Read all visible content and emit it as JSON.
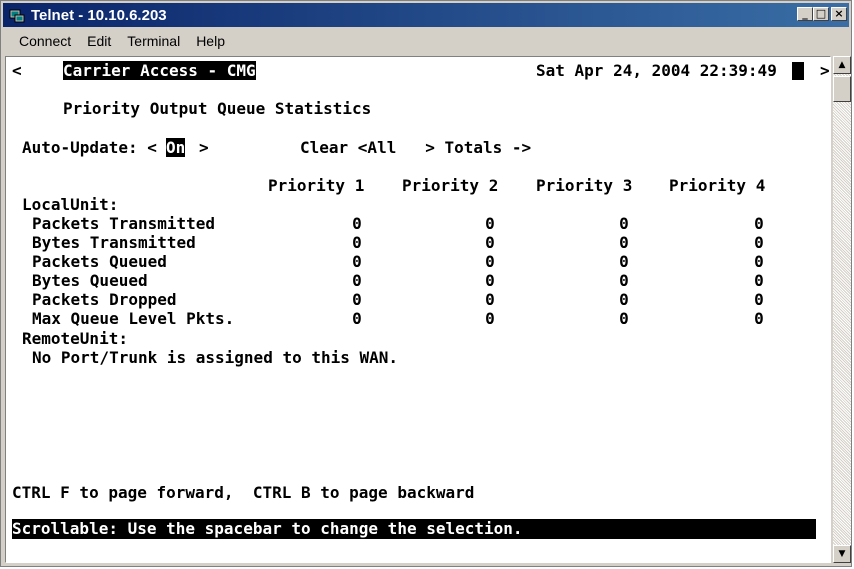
{
  "window": {
    "title": "Telnet - 10.10.6.203",
    "icon": "telnet-app-icon",
    "controls": {
      "minimize": "_",
      "maximize": "□",
      "close": "×"
    }
  },
  "menu": [
    "Connect",
    "Edit",
    "Terminal",
    "Help"
  ],
  "terminal": {
    "nav_left": "<",
    "nav_right": ">",
    "header": "Carrier Access - CMG",
    "datetime": "Sat Apr 24, 2004 22:39:49",
    "screen_title": "Priority Output Queue Statistics",
    "auto_update_label": "Auto-Update: <",
    "auto_update_value": "On",
    "auto_update_close": ">",
    "clear_label": "Clear <All   > Totals ->",
    "columns": [
      "Priority 1",
      "Priority 2",
      "Priority 3",
      "Priority 4"
    ],
    "local_unit_label": "LocalUnit:",
    "rows": [
      {
        "label": "Packets Transmitted",
        "values": [
          "0",
          "0",
          "0",
          "0"
        ]
      },
      {
        "label": "Bytes Transmitted",
        "values": [
          "0",
          "0",
          "0",
          "0"
        ]
      },
      {
        "label": "Packets Queued",
        "values": [
          "0",
          "0",
          "0",
          "0"
        ]
      },
      {
        "label": "Bytes Queued",
        "values": [
          "0",
          "0",
          "0",
          "0"
        ]
      },
      {
        "label": "Packets Dropped",
        "values": [
          "0",
          "0",
          "0",
          "0"
        ]
      },
      {
        "label": "Max Queue Level Pkts.",
        "values": [
          "0",
          "0",
          "0",
          "0"
        ]
      }
    ],
    "remote_unit_label": "RemoteUnit:",
    "remote_message": "No Port/Trunk is assigned to this WAN.",
    "paging_hint": "CTRL F to page forward,  CTRL B to page backward",
    "status_message": "Scrollable: Use the spacebar to change the selection."
  },
  "scrollbar": {
    "up_arrow": "▲",
    "down_arrow": "▼"
  }
}
